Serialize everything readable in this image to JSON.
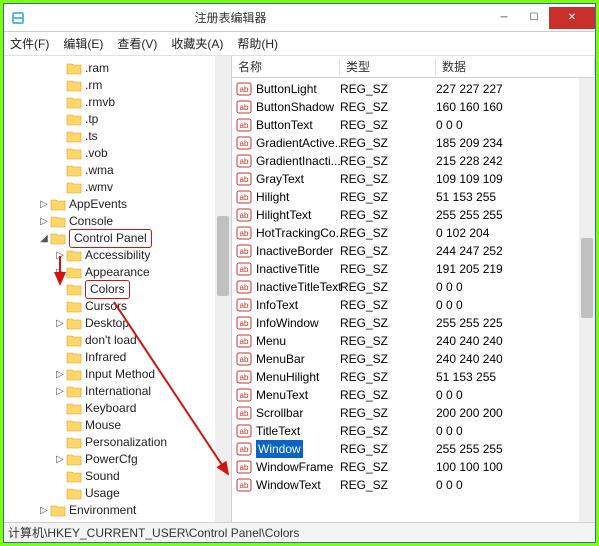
{
  "window": {
    "title": "注册表编辑器"
  },
  "menu": {
    "file": "文件(F)",
    "edit": "编辑(E)",
    "view": "查看(V)",
    "fav": "收藏夹(A)",
    "help": "帮助(H)"
  },
  "tree": {
    "items": [
      {
        "indent": 3,
        "exp": "",
        "label": ".ram"
      },
      {
        "indent": 3,
        "exp": "",
        "label": ".rm"
      },
      {
        "indent": 3,
        "exp": "",
        "label": ".rmvb"
      },
      {
        "indent": 3,
        "exp": "",
        "label": ".tp"
      },
      {
        "indent": 3,
        "exp": "",
        "label": ".ts"
      },
      {
        "indent": 3,
        "exp": "",
        "label": ".vob"
      },
      {
        "indent": 3,
        "exp": "",
        "label": ".wma"
      },
      {
        "indent": 3,
        "exp": "",
        "label": ".wmv"
      },
      {
        "indent": 2,
        "exp": "▷",
        "label": "AppEvents"
      },
      {
        "indent": 2,
        "exp": "▷",
        "label": "Console"
      },
      {
        "indent": 2,
        "exp": "◢",
        "label": "Control Panel",
        "hl": true
      },
      {
        "indent": 3,
        "exp": "▷",
        "label": "Accessibility"
      },
      {
        "indent": 3,
        "exp": "▷",
        "label": "Appearance"
      },
      {
        "indent": 3,
        "exp": "",
        "label": "Colors",
        "hl": true
      },
      {
        "indent": 3,
        "exp": "",
        "label": "Cursors"
      },
      {
        "indent": 3,
        "exp": "▷",
        "label": "Desktop"
      },
      {
        "indent": 3,
        "exp": "",
        "label": "don't load"
      },
      {
        "indent": 3,
        "exp": "",
        "label": "Infrared"
      },
      {
        "indent": 3,
        "exp": "▷",
        "label": "Input Method"
      },
      {
        "indent": 3,
        "exp": "▷",
        "label": "International"
      },
      {
        "indent": 3,
        "exp": "",
        "label": "Keyboard"
      },
      {
        "indent": 3,
        "exp": "",
        "label": "Mouse"
      },
      {
        "indent": 3,
        "exp": "",
        "label": "Personalization"
      },
      {
        "indent": 3,
        "exp": "▷",
        "label": "PowerCfg"
      },
      {
        "indent": 3,
        "exp": "",
        "label": "Sound"
      },
      {
        "indent": 3,
        "exp": "",
        "label": "Usage"
      },
      {
        "indent": 2,
        "exp": "▷",
        "label": "Environment"
      }
    ]
  },
  "list": {
    "headers": {
      "name": "名称",
      "type": "类型",
      "data": "数据"
    },
    "rows": [
      {
        "name": "ButtonLight",
        "type": "REG_SZ",
        "data": "227 227 227"
      },
      {
        "name": "ButtonShadow",
        "type": "REG_SZ",
        "data": "160 160 160"
      },
      {
        "name": "ButtonText",
        "type": "REG_SZ",
        "data": "0 0 0"
      },
      {
        "name": "GradientActive...",
        "type": "REG_SZ",
        "data": "185 209 234"
      },
      {
        "name": "GradientInacti...",
        "type": "REG_SZ",
        "data": "215 228 242"
      },
      {
        "name": "GrayText",
        "type": "REG_SZ",
        "data": "109 109 109"
      },
      {
        "name": "Hilight",
        "type": "REG_SZ",
        "data": "51 153 255"
      },
      {
        "name": "HilightText",
        "type": "REG_SZ",
        "data": "255 255 255"
      },
      {
        "name": "HotTrackingCo...",
        "type": "REG_SZ",
        "data": "0 102 204"
      },
      {
        "name": "InactiveBorder",
        "type": "REG_SZ",
        "data": "244 247 252"
      },
      {
        "name": "InactiveTitle",
        "type": "REG_SZ",
        "data": "191 205 219"
      },
      {
        "name": "InactiveTitleText",
        "type": "REG_SZ",
        "data": "0 0 0"
      },
      {
        "name": "InfoText",
        "type": "REG_SZ",
        "data": "0 0 0"
      },
      {
        "name": "InfoWindow",
        "type": "REG_SZ",
        "data": "255 255 225"
      },
      {
        "name": "Menu",
        "type": "REG_SZ",
        "data": "240 240 240"
      },
      {
        "name": "MenuBar",
        "type": "REG_SZ",
        "data": "240 240 240"
      },
      {
        "name": "MenuHilight",
        "type": "REG_SZ",
        "data": "51 153 255"
      },
      {
        "name": "MenuText",
        "type": "REG_SZ",
        "data": "0 0 0"
      },
      {
        "name": "Scrollbar",
        "type": "REG_SZ",
        "data": "200 200 200"
      },
      {
        "name": "TitleText",
        "type": "REG_SZ",
        "data": "0 0 0"
      },
      {
        "name": "Window",
        "type": "REG_SZ",
        "data": "255 255 255",
        "sel": true
      },
      {
        "name": "WindowFrame",
        "type": "REG_SZ",
        "data": "100 100 100"
      },
      {
        "name": "WindowText",
        "type": "REG_SZ",
        "data": "0 0 0"
      }
    ]
  },
  "statusbar": {
    "path": "计算机\\HKEY_CURRENT_USER\\Control Panel\\Colors"
  },
  "annotation": {
    "highlight_color": "#d01414"
  }
}
